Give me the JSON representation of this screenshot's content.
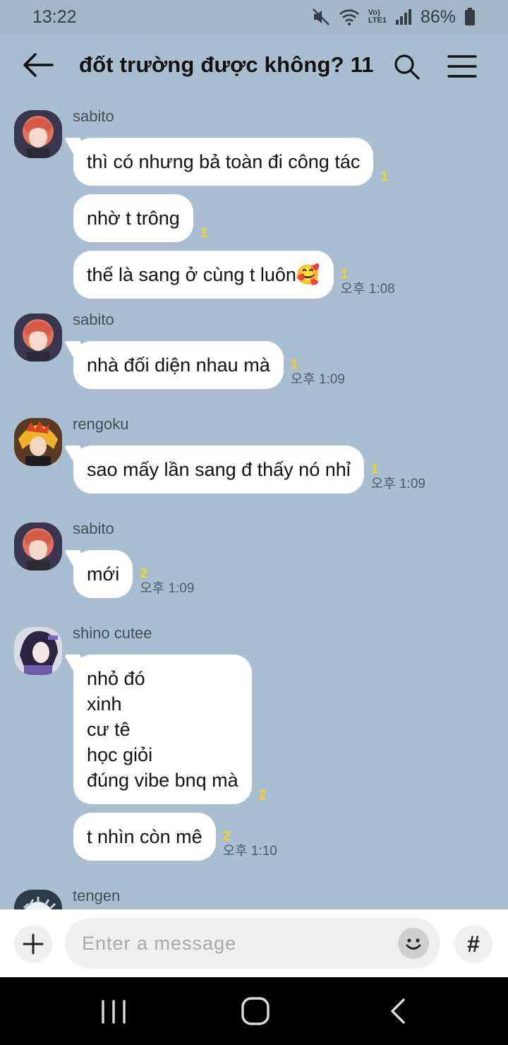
{
  "status_bar": {
    "time": "13:22",
    "battery": "86%",
    "network": "LTE1",
    "carrier_badge": "Vo)"
  },
  "header": {
    "title": "đốt trường được không? 11"
  },
  "groups": [
    {
      "sender": "sabito",
      "messages": [
        {
          "text": "thì có nhưng bả toàn đi công tác",
          "unread": "1",
          "time": ""
        },
        {
          "text": "nhờ t trông",
          "unread": "1",
          "time": ""
        },
        {
          "text": "thế là sang ở cùng t luôn🥰",
          "unread": "1",
          "time": "오후 1:08"
        }
      ]
    },
    {
      "sender": "sabito",
      "messages": [
        {
          "text": "nhà đối diện nhau mà",
          "unread": "1",
          "time": "오후 1:09"
        }
      ]
    },
    {
      "sender": "rengoku",
      "messages": [
        {
          "text": "sao mấy lần sang đ thấy nó nhỉ",
          "unread": "1",
          "time": "오후 1:09"
        }
      ]
    },
    {
      "sender": "sabito",
      "messages": [
        {
          "text": "mới",
          "unread": "2",
          "time": "오후 1:09"
        }
      ]
    },
    {
      "sender": "shino cutee",
      "messages": [
        {
          "text": "nhỏ đó\nxinh\ncư tê\nhọc giỏi\nđúng vibe bnq mà",
          "unread": "2",
          "time": ""
        },
        {
          "text": "t nhìn còn mê",
          "unread": "2",
          "time": "오후 1:10"
        }
      ]
    },
    {
      "sender": "tengen",
      "messages": []
    }
  ],
  "input": {
    "placeholder": "Enter a message",
    "hash_label": "#"
  },
  "colors": {
    "background": "#a9bfd1",
    "bubble": "#ffffff",
    "unread": "#f2d41c"
  }
}
